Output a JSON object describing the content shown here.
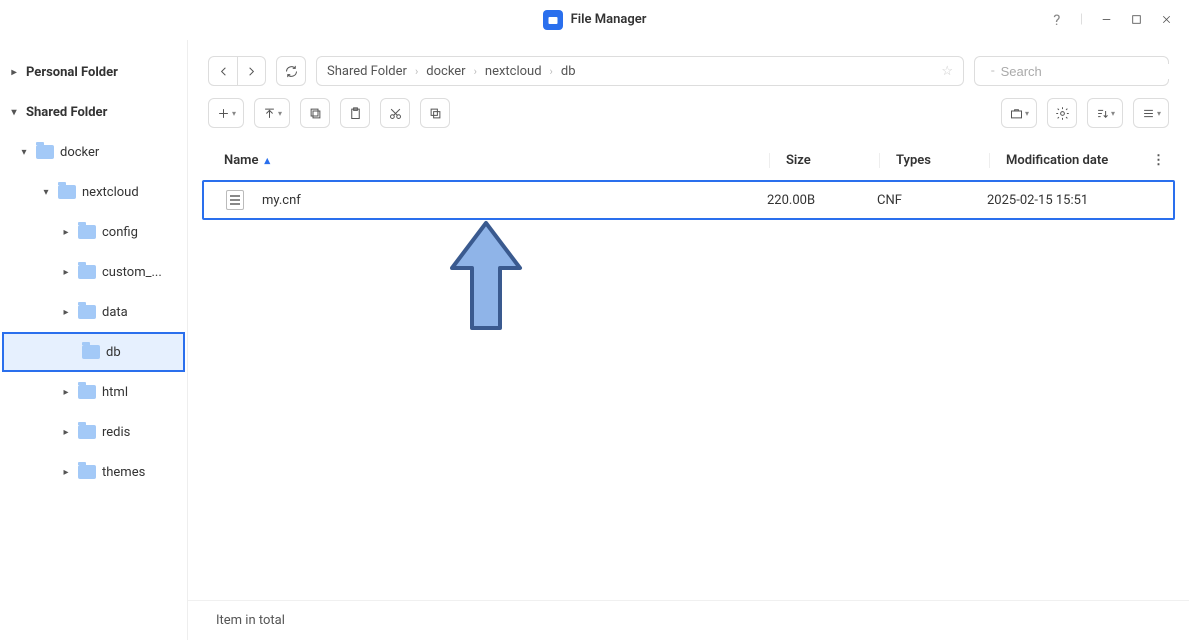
{
  "app": {
    "title": "File Manager"
  },
  "sidebar": {
    "personal": "Personal Folder",
    "shared": "Shared Folder",
    "tree": {
      "docker": "docker",
      "nextcloud": "nextcloud",
      "children": {
        "config": "config",
        "custom": "custom_...",
        "data": "data",
        "db": "db",
        "html": "html",
        "redis": "redis",
        "themes": "themes"
      }
    }
  },
  "breadcrumb": {
    "c0": "Shared Folder",
    "c1": "docker",
    "c2": "nextcloud",
    "c3": "db"
  },
  "search": {
    "placeholder": "Search"
  },
  "columns": {
    "name": "Name",
    "size": "Size",
    "types": "Types",
    "date": "Modification date"
  },
  "files": [
    {
      "name": "my.cnf",
      "size": "220.00B",
      "types": "CNF",
      "date": "2025-02-15 15:51"
    }
  ],
  "status": "Item in total"
}
